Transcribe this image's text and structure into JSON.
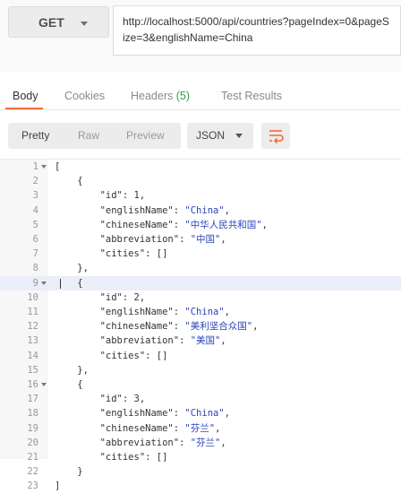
{
  "request": {
    "method": "GET",
    "url": "http://localhost:5000/api/countries?pageIndex=0&pageSize=3&englishName=China"
  },
  "response_tabs": [
    {
      "label": "Body",
      "active": true
    },
    {
      "label": "Cookies",
      "active": false
    },
    {
      "label": "Headers",
      "count": "(5)",
      "active": false
    },
    {
      "label": "Test Results",
      "active": false
    }
  ],
  "toolbar": {
    "modes": [
      "Pretty",
      "Raw",
      "Preview"
    ],
    "active_mode": "Pretty",
    "format": "JSON",
    "wrap_icon": "wrap-lines-icon"
  },
  "colors": {
    "accent": "#f26b3a",
    "string": "#2b46ba",
    "count": "#2ea043"
  },
  "code_lines": [
    {
      "n": "1",
      "text": "[",
      "fold": true
    },
    {
      "n": "2",
      "text": "    {",
      "fold": false
    },
    {
      "n": "3",
      "text": "        \"id\": 1,",
      "fold": false
    },
    {
      "n": "4",
      "text": "        \"englishName\": \"China\",",
      "fold": false
    },
    {
      "n": "5",
      "text": "        \"chineseName\": \"中华人民共和国\",",
      "fold": false
    },
    {
      "n": "6",
      "text": "        \"abbreviation\": \"中国\",",
      "fold": false
    },
    {
      "n": "7",
      "text": "        \"cities\": []",
      "fold": false
    },
    {
      "n": "8",
      "text": "    },",
      "fold": false
    },
    {
      "n": "9",
      "text": "    {",
      "fold": true,
      "highlight": true
    },
    {
      "n": "10",
      "text": "        \"id\": 2,",
      "fold": false
    },
    {
      "n": "11",
      "text": "        \"englishName\": \"China\",",
      "fold": false
    },
    {
      "n": "12",
      "text": "        \"chineseName\": \"美利坚合众国\",",
      "fold": false
    },
    {
      "n": "13",
      "text": "        \"abbreviation\": \"美国\",",
      "fold": false
    },
    {
      "n": "14",
      "text": "        \"cities\": []",
      "fold": false
    },
    {
      "n": "15",
      "text": "    },",
      "fold": false
    },
    {
      "n": "16",
      "text": "    {",
      "fold": true
    },
    {
      "n": "17",
      "text": "        \"id\": 3,",
      "fold": false
    },
    {
      "n": "18",
      "text": "        \"englishName\": \"China\",",
      "fold": false
    },
    {
      "n": "19",
      "text": "        \"chineseName\": \"芬兰\",",
      "fold": false
    },
    {
      "n": "20",
      "text": "        \"abbreviation\": \"芬兰\",",
      "fold": false
    },
    {
      "n": "21",
      "text": "        \"cities\": []",
      "fold": false
    },
    {
      "n": "22",
      "text": "    }",
      "fold": false
    },
    {
      "n": "23",
      "text": "]",
      "fold": false
    }
  ]
}
